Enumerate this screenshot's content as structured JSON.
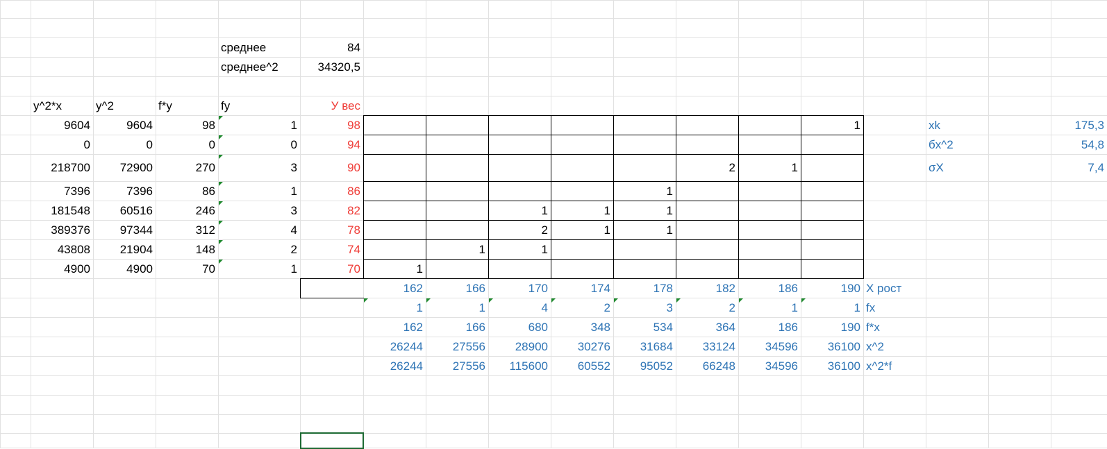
{
  "summary": {
    "mean_label": "среднее",
    "mean_value": "84",
    "meansq_label": "среднее^2",
    "meansq_value": "34320,5"
  },
  "headers": {
    "y2x": "y^2*x",
    "y2": "y^2",
    "fy_mult": "f*y",
    "fy": "fy",
    "y_weight": "У вес"
  },
  "rows": [
    {
      "y2x": "9604",
      "y2": "9604",
      "fy_mult": "98",
      "fy": "1",
      "y": "98",
      "cells": [
        "",
        "",
        "",
        "",
        "",
        "",
        "",
        "1"
      ]
    },
    {
      "y2x": "0",
      "y2": "0",
      "fy_mult": "0",
      "fy": "0",
      "y": "94",
      "cells": [
        "",
        "",
        "",
        "",
        "",
        "",
        "",
        ""
      ]
    },
    {
      "y2x": "218700",
      "y2": "72900",
      "fy_mult": "270",
      "fy": "3",
      "y": "90",
      "cells": [
        "",
        "",
        "",
        "",
        "",
        "2",
        "1",
        ""
      ]
    },
    {
      "y2x": "7396",
      "y2": "7396",
      "fy_mult": "86",
      "fy": "1",
      "y": "86",
      "cells": [
        "",
        "",
        "",
        "",
        "1",
        "",
        "",
        ""
      ]
    },
    {
      "y2x": "181548",
      "y2": "60516",
      "fy_mult": "246",
      "fy": "3",
      "y": "82",
      "cells": [
        "",
        "",
        "1",
        "1",
        "1",
        "",
        "",
        ""
      ]
    },
    {
      "y2x": "389376",
      "y2": "97344",
      "fy_mult": "312",
      "fy": "4",
      "y": "78",
      "cells": [
        "",
        "",
        "2",
        "1",
        "1",
        "",
        "",
        ""
      ]
    },
    {
      "y2x": "43808",
      "y2": "21904",
      "fy_mult": "148",
      "fy": "2",
      "y": "74",
      "cells": [
        "",
        "1",
        "1",
        "",
        "",
        "",
        "",
        ""
      ]
    },
    {
      "y2x": "4900",
      "y2": "4900",
      "fy_mult": "70",
      "fy": "1",
      "y": "70",
      "cells": [
        "1",
        "",
        "",
        "",
        "",
        "",
        "",
        ""
      ]
    }
  ],
  "x_rows": [
    {
      "label": "X рост",
      "values": [
        "162",
        "166",
        "170",
        "174",
        "178",
        "182",
        "186",
        "190"
      ]
    },
    {
      "label": "fx",
      "values": [
        "1",
        "1",
        "4",
        "2",
        "3",
        "2",
        "1",
        "1"
      ]
    },
    {
      "label": "f*x",
      "values": [
        "162",
        "166",
        "680",
        "348",
        "534",
        "364",
        "186",
        "190"
      ]
    },
    {
      "label": "x^2",
      "values": [
        "26244",
        "27556",
        "28900",
        "30276",
        "31684",
        "33124",
        "34596",
        "36100"
      ]
    },
    {
      "label": "x^2*f",
      "values": [
        "26244",
        "27556",
        "115600",
        "60552",
        "95052",
        "66248",
        "34596",
        "36100"
      ]
    }
  ],
  "stats": [
    {
      "label": "xk",
      "value": "175,3"
    },
    {
      "label": "бx^2",
      "value": "54,8"
    },
    {
      "label": "σX",
      "value": "7,4"
    }
  ],
  "colors": {
    "y_weight": "#ef3b36",
    "x_section": "#2e74b5",
    "gridline": "#e1e1e1",
    "comment_marker": "#1f8a2e",
    "selection": "#1e6b34"
  }
}
